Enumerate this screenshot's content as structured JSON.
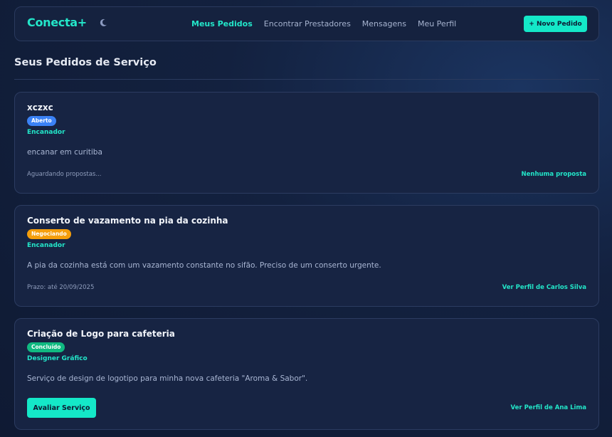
{
  "header": {
    "logo": "Conecta+",
    "nav": [
      "Meus Pedidos",
      "Encontrar Prestadores",
      "Mensagens",
      "Meu Perfil"
    ],
    "new_order_label": "+ Novo Pedido"
  },
  "main": {
    "title": "Seus Pedidos de Serviço",
    "orders": [
      {
        "title": "xczxc",
        "status": "Aberto",
        "status_color": "#3b82f6",
        "category": "Encanador",
        "description": "encanar em curitiba",
        "footer_left": "Aguardando propostas...",
        "footer_right": "Nenhuma proposta"
      },
      {
        "title": "Conserto de vazamento na pia da cozinha",
        "status": "Negociando",
        "status_color": "#f59e0b",
        "category": "Encanador",
        "description": "A pia da cozinha está com um vazamento constante no sifão. Preciso de um conserto urgente.",
        "footer_left": "Prazo: até 20/09/2025",
        "footer_right": "Ver Perfil de Carlos Silva"
      },
      {
        "title": "Criação de Logo para cafeteria",
        "status": "Concluído",
        "status_color": "#10b981",
        "category": "Designer Gráfico",
        "description": "Serviço de design de logotipo para minha nova cafeteria \"Aroma & Sabor\".",
        "action_label": "Avaliar Serviço",
        "footer_right": "Ver Perfil de Ana Lima"
      }
    ]
  },
  "colors": {
    "accent": "#23e6c9",
    "background": "#13213f",
    "card": "#172443"
  },
  "icons": {
    "theme_toggle": "moon-icon"
  }
}
